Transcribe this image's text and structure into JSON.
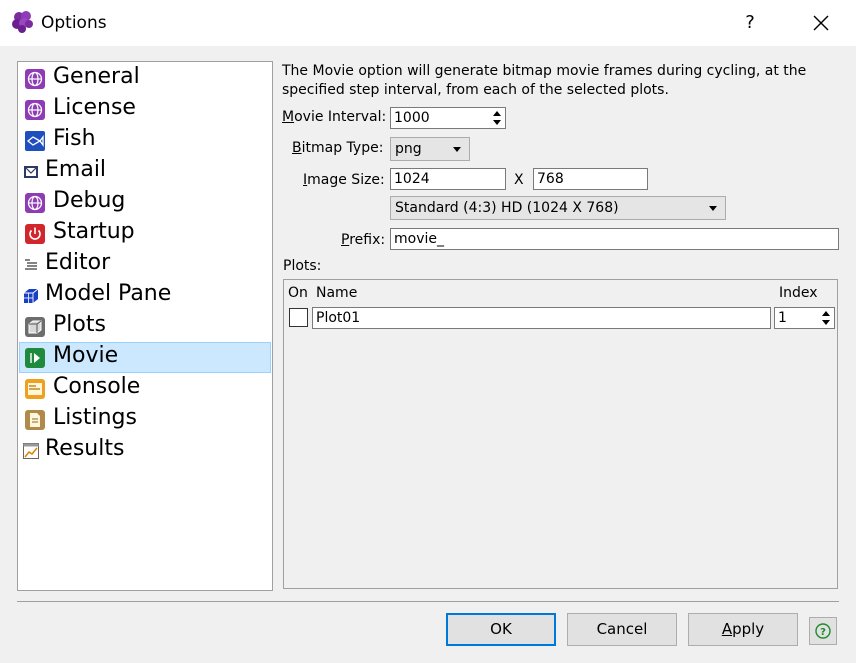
{
  "window": {
    "title": "Options",
    "help_symbol": "?"
  },
  "sidebar": {
    "items": [
      {
        "label": "General",
        "icon": "globe-icon"
      },
      {
        "label": "License",
        "icon": "globe-icon"
      },
      {
        "label": "Fish",
        "icon": "fish-icon"
      },
      {
        "label": "Email",
        "icon": "email-icon"
      },
      {
        "label": "Debug",
        "icon": "globe-icon"
      },
      {
        "label": "Startup",
        "icon": "power-icon"
      },
      {
        "label": "Editor",
        "icon": "editor-icon"
      },
      {
        "label": "Model Pane",
        "icon": "cube-grid-icon"
      },
      {
        "label": "Plots",
        "icon": "cube-icon"
      },
      {
        "label": "Movie",
        "icon": "movie-icon"
      },
      {
        "label": "Console",
        "icon": "console-icon"
      },
      {
        "label": "Listings",
        "icon": "document-icon"
      },
      {
        "label": "Results",
        "icon": "chart-icon"
      }
    ],
    "selected": "Movie"
  },
  "movie": {
    "description": "The Movie option will generate bitmap movie frames during cycling, at the specified step interval, from each of the selected plots.",
    "interval_label_first": "M",
    "interval_label_rest": "ovie Interval:",
    "interval_value": "1000",
    "bitmap_label_first": "B",
    "bitmap_label_rest": "itmap Type:",
    "bitmap_value": "png",
    "size_label_first": "I",
    "size_label_rest": "mage Size:",
    "width_value": "1024",
    "x_separator": "X",
    "height_value": "768",
    "preset_value": "Standard (4:3) HD (1024 X 768)",
    "prefix_label_first": "P",
    "prefix_label_rest": "refix:",
    "prefix_value": "movie_",
    "plots_label": "Plots:"
  },
  "plots_table": {
    "col_on": "On",
    "col_name": "Name",
    "col_index": "Index",
    "rows": [
      {
        "on": false,
        "name": "Plot01",
        "index": "1"
      }
    ]
  },
  "buttons": {
    "ok": "OK",
    "cancel": "Cancel",
    "apply_first": "A",
    "apply_rest": "pply"
  }
}
